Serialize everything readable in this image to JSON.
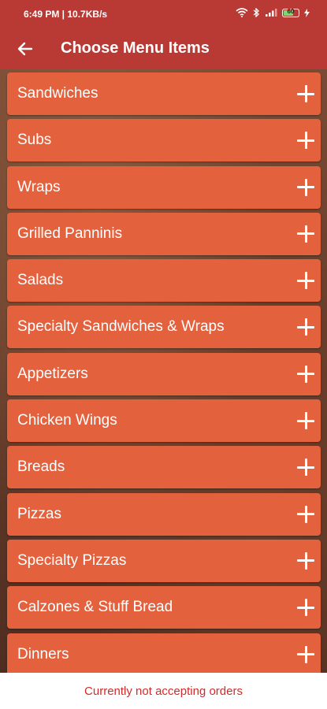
{
  "status_bar": {
    "time": "6:49 PM | 10.7KB/s",
    "battery": "60"
  },
  "header": {
    "title": "Choose Menu Items"
  },
  "menu": {
    "items": [
      {
        "label": "Sandwiches"
      },
      {
        "label": "Subs"
      },
      {
        "label": "Wraps"
      },
      {
        "label": "Grilled Panninis"
      },
      {
        "label": "Salads"
      },
      {
        "label": "Specialty Sandwiches & Wraps"
      },
      {
        "label": "Appetizers"
      },
      {
        "label": "Chicken Wings"
      },
      {
        "label": "Breads"
      },
      {
        "label": "Pizzas"
      },
      {
        "label": "Specialty Pizzas"
      },
      {
        "label": "Calzones & Stuff Bread"
      },
      {
        "label": "Dinners"
      }
    ]
  },
  "footer": {
    "message": "Currently not accepting orders"
  },
  "colors": {
    "app_bar": "#b93a34",
    "item_background": "#e4613d",
    "footer_text": "#d42a2a"
  }
}
